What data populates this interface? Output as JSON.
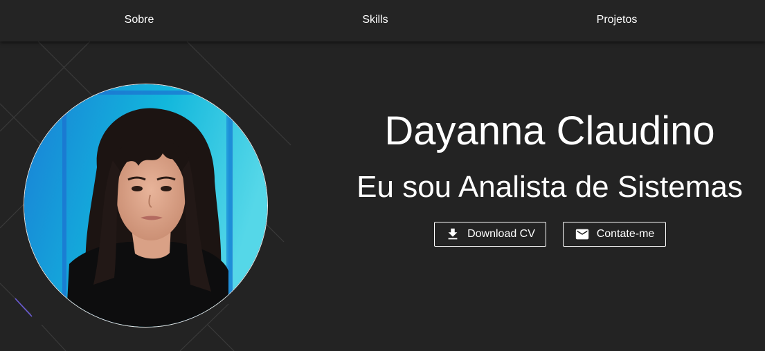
{
  "navbar": {
    "items": [
      {
        "label": "Sobre"
      },
      {
        "label": "Skills"
      },
      {
        "label": "Projetos"
      }
    ]
  },
  "hero": {
    "name": "Dayanna Claudino",
    "role": "Eu sou Analista de Sistemas",
    "buttons": {
      "download": {
        "label": "Download CV",
        "icon": "download-icon"
      },
      "contact": {
        "label": "Contate-me",
        "icon": "mail-icon"
      }
    },
    "avatar": {
      "alt": "profile-photo"
    }
  },
  "colors": {
    "background": "#232323",
    "navbar": "#242424",
    "text": "#ffffff",
    "avatar_gradient_start": "#1d84dc",
    "avatar_gradient_end": "#4fd3e6",
    "accent_line": "#6b5bd8"
  }
}
